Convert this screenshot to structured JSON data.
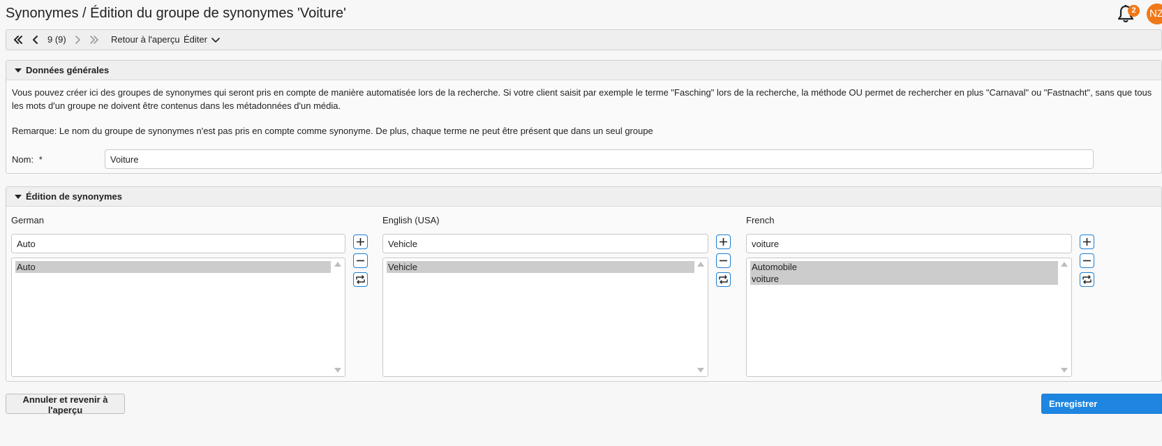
{
  "header": {
    "title": "Synonymes / Édition du groupe de synonymes 'Voiture'",
    "notification_count": "2",
    "avatar_initials": "NZ"
  },
  "toolbar": {
    "position": "9 (9)",
    "back_label": "Retour à l'aperçu",
    "edit_label": "Éditer"
  },
  "general": {
    "title": "Données générales",
    "description": "Vous pouvez créer ici des groupes de synonymes qui seront pris en compte de manière automatisée lors de la recherche. Si votre client saisit par exemple le terme \"Fasching\" lors de la recherche, la méthode OU permet de rechercher en plus \"Carnaval\" ou \"Fastnacht\", sans que tous les mots d'un groupe ne doivent être contenus dans les métadonnées d'un média.",
    "remark": "Remarque: Le nom du groupe de synonymes n'est pas pris en compte comme synonyme. De plus, chaque terme ne peut être présent que dans un seul groupe",
    "name_label": "Nom:",
    "required_mark": "*",
    "name_value": "Voiture"
  },
  "synonyms": {
    "title": "Édition de synonymes",
    "languages": [
      {
        "label": "German",
        "input_value": "Auto",
        "items": [
          "Auto"
        ]
      },
      {
        "label": "English (USA)",
        "input_value": "Vehicle",
        "items": [
          "Vehicle"
        ]
      },
      {
        "label": "French",
        "input_value": "voiture",
        "items": [
          "Automobile",
          "voiture"
        ]
      }
    ]
  },
  "footer": {
    "cancel_label": "Annuler et revenir à l'aperçu",
    "save_label": "Enregistrer"
  },
  "colors": {
    "accent": "#1e86e0",
    "badge": "#f07818"
  }
}
